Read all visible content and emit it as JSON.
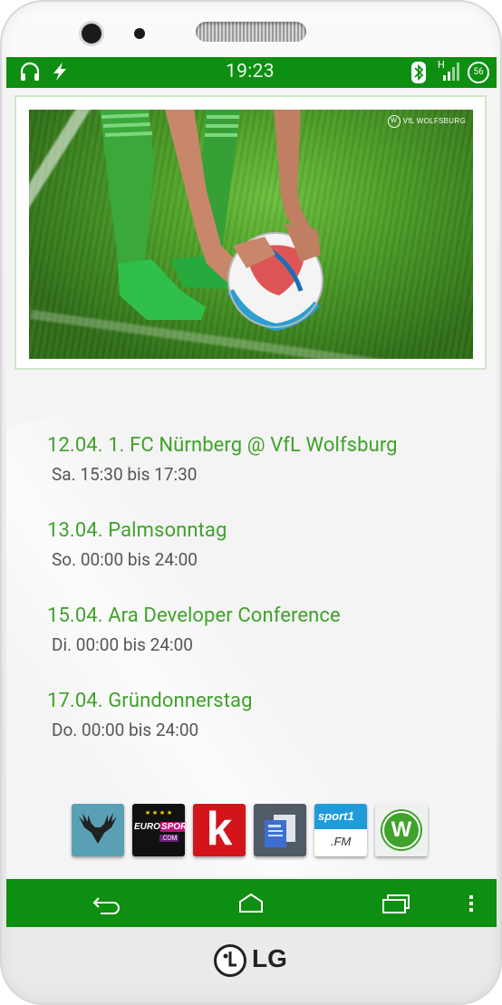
{
  "status_bar": {
    "time": "19:23",
    "battery": "56",
    "network": "H",
    "icons": [
      "headphones-icon",
      "lightning-icon",
      "bluetooth-icon",
      "signal-icon",
      "battery-icon"
    ]
  },
  "banner": {
    "logo_text": "VfL WOLFSBURG"
  },
  "events": [
    {
      "title": "12.04. 1. FC Nürnberg @ VfL Wolfsburg",
      "time": "Sa. 15:30 bis 17:30"
    },
    {
      "title": "13.04. Palmsonntag",
      "time": "So. 00:00 bis 24:00"
    },
    {
      "title": "15.04. Ara Developer Conference",
      "time": "Di. 00:00 bis 24:00"
    },
    {
      "title": "17.04. Gründonnerstag",
      "time": "Do. 00:00 bis 24:00"
    }
  ],
  "shortcuts": [
    {
      "name": "deer-app",
      "icon": "deer-icon"
    },
    {
      "name": "eurosport",
      "label_top": "EURO",
      "label_mid": "SPORT",
      "label_bot": ".COM"
    },
    {
      "name": "kicker",
      "label": "k"
    },
    {
      "name": "news-app",
      "icon": "newspaper-icon"
    },
    {
      "name": "sport1-fm",
      "label_top": "sport1",
      "label_bot": ".FM"
    },
    {
      "name": "vfl-wolfsburg",
      "label": "W"
    }
  ],
  "navbar": [
    "back-icon",
    "home-icon",
    "recents-icon",
    "menu-icon"
  ],
  "brand": {
    "name": "LG"
  },
  "colors": {
    "accent": "#0e8f12",
    "event_title": "#3fa22a",
    "event_time": "#555555"
  }
}
